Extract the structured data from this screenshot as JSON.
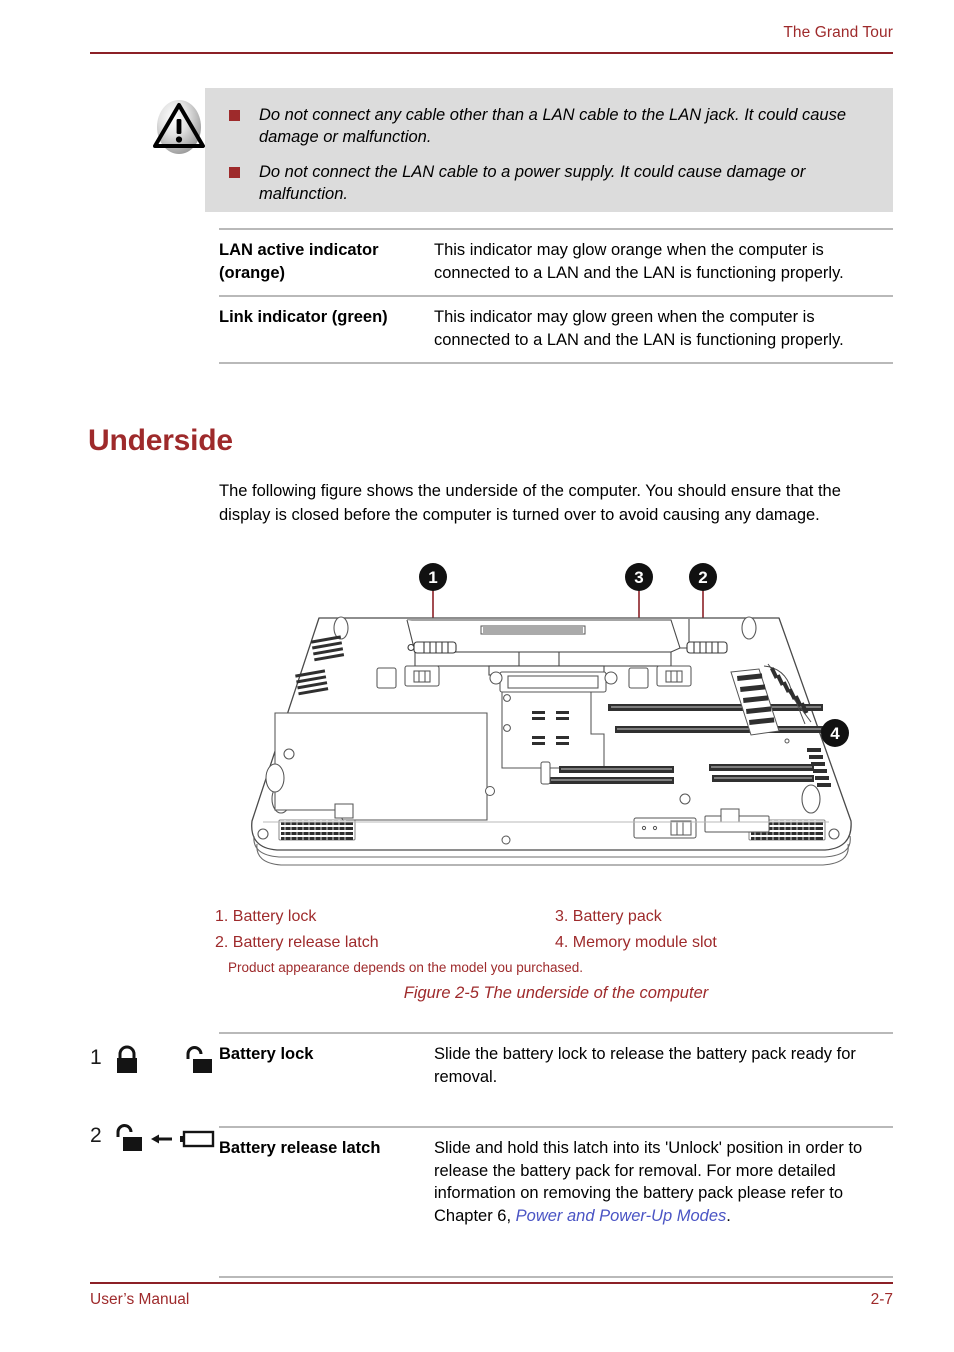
{
  "header": {
    "title": "The Grand Tour",
    "rule_color": "#8c2026"
  },
  "caution": {
    "icon": "warning-triangle-icon",
    "background": "#dcdcdc",
    "bullet_color": "#9e2a2b",
    "items": [
      "Do not connect any cable other than a LAN cable to the LAN jack. It could cause damage or malfunction.",
      "Do not connect the LAN cable to a power supply. It could cause damage or malfunction."
    ]
  },
  "lan_table": {
    "rows": [
      {
        "term": "LAN active indicator (orange)",
        "desc": "This indicator may glow orange when the computer is connected to a LAN and the LAN is functioning properly."
      },
      {
        "term": "Link indicator (green)",
        "desc": "This indicator may glow green when the computer is connected to a LAN and the LAN is functioning properly."
      }
    ]
  },
  "section": {
    "heading": "Underside",
    "heading_color": "#9e2a2b",
    "intro": "The following figure shows the underside of the computer. You should ensure that the display is closed before the computer is turned over to avoid causing any damage."
  },
  "figure": {
    "callouts": [
      "1",
      "3",
      "2",
      "4"
    ],
    "legend_left": [
      "1. Battery lock",
      "2. Battery release latch"
    ],
    "legend_right": [
      "3. Battery pack",
      "4. Memory module slot"
    ],
    "note": "Product appearance depends on the model you purchased.",
    "caption": "Figure 2-5 The underside of the computer",
    "caption_color": "#9e2a2b"
  },
  "battery_table": {
    "rows": [
      {
        "number": "1",
        "icons": [
          "lock-closed-icon",
          "lock-open-icon"
        ],
        "term": "Battery lock",
        "desc": "Slide the battery lock to release the battery pack ready for removal.",
        "desc_plain": "",
        "link_text": "",
        "desc_tail": ""
      },
      {
        "number": "2",
        "icons": [
          "lock-open-icon",
          "arrow-left-icon",
          "battery-icon"
        ],
        "term": "Battery release latch",
        "desc_plain": "Slide and hold this latch into its 'Unlock' position in order to release the battery pack for removal. For more detailed information on removing the battery pack please refer to Chapter 6, ",
        "link_text": "Power and Power-Up Modes",
        "link_color": "#4a54c4",
        "desc_tail": "."
      }
    ]
  },
  "footer": {
    "left": "User’s Manual",
    "right": "2-7",
    "rule_color": "#8c2026"
  }
}
